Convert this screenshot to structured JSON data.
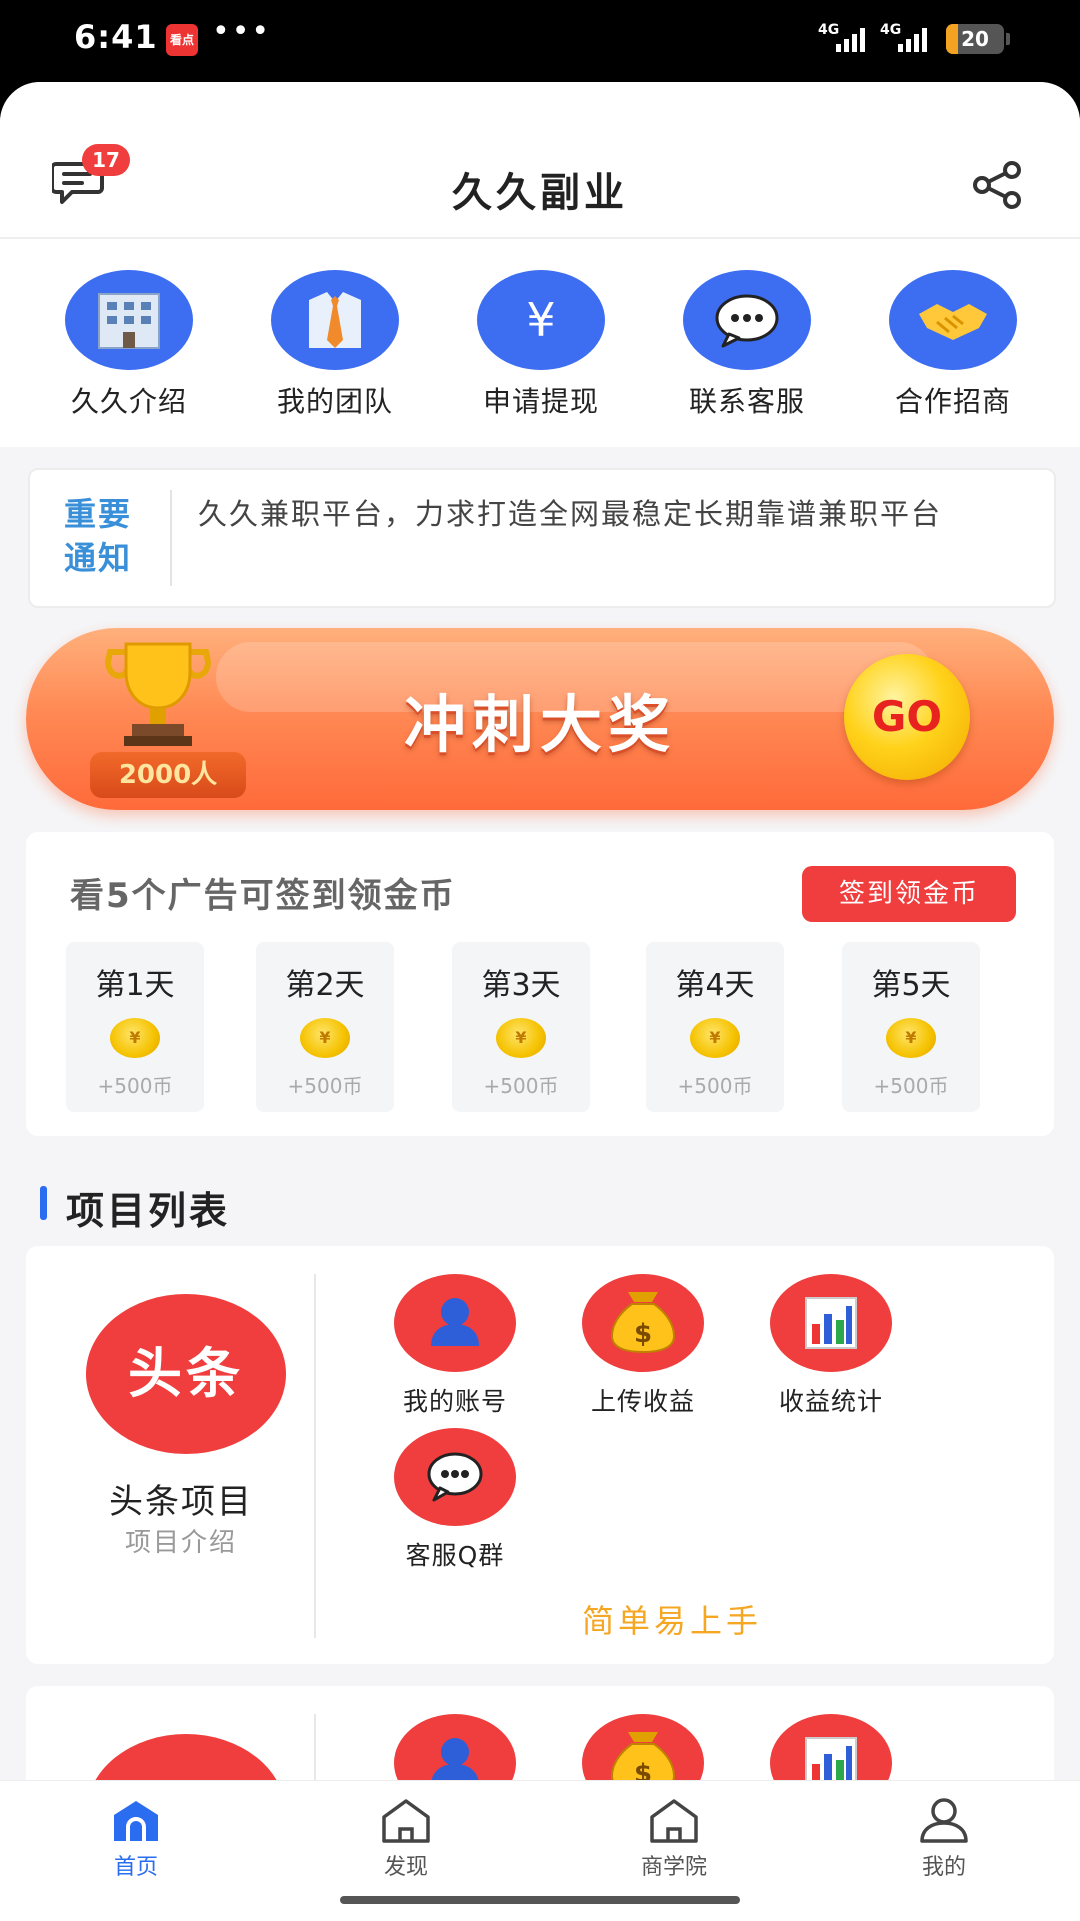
{
  "status_bar": {
    "time": "6:41",
    "app_badge": "看点",
    "dots": "•••",
    "network1": "4G",
    "network2": "4G",
    "battery": "20",
    "battery_level": 0.2,
    "battery_color": "#f3a321"
  },
  "header": {
    "title": "久久副业",
    "message_badge": "17",
    "message_icon": "chat-icon",
    "share_icon": "share-icon"
  },
  "quick_menu": [
    {
      "label": "久久介绍",
      "icon": "building-icon"
    },
    {
      "label": "我的团队",
      "icon": "shirt-tie-icon"
    },
    {
      "label": "申请提现",
      "icon": "yen-icon"
    },
    {
      "label": "联系客服",
      "icon": "chat-bubble-icon"
    },
    {
      "label": "合作招商",
      "icon": "handshake-icon"
    }
  ],
  "notice": {
    "tag": "重要通知",
    "text": "久久兼职平台，力求打造全网最稳定长期靠谱兼职平台"
  },
  "banner": {
    "title": "冲刺大奖",
    "count": "2000人",
    "go": "GO"
  },
  "signin": {
    "title": "看5个广告可签到领金币",
    "button": "签到领金币",
    "days": [
      {
        "label": "第1天",
        "reward": "+500币"
      },
      {
        "label": "第2天",
        "reward": "+500币"
      },
      {
        "label": "第3天",
        "reward": "+500币"
      },
      {
        "label": "第4天",
        "reward": "+500币"
      },
      {
        "label": "第5天",
        "reward": "+500币"
      }
    ],
    "coin_symbol": "¥"
  },
  "projects": {
    "section_title": "项目列表",
    "items": [
      {
        "badge": "头条",
        "name": "头条项目",
        "sub": "项目介绍",
        "actions": [
          {
            "label": "我的账号",
            "icon": "user-icon"
          },
          {
            "label": "上传收益",
            "icon": "money-bag-icon"
          },
          {
            "label": "收益统计",
            "icon": "bar-chart-icon"
          },
          {
            "label": "客服Q群",
            "icon": "chat-bubble-icon"
          }
        ],
        "tagline": "简单易上手"
      }
    ]
  },
  "bottom_nav": [
    {
      "label": "首页",
      "icon": "home-icon",
      "active": true
    },
    {
      "label": "发现",
      "icon": "discover-icon",
      "active": false
    },
    {
      "label": "商学院",
      "icon": "school-icon",
      "active": false
    },
    {
      "label": "我的",
      "icon": "profile-icon",
      "active": false
    }
  ],
  "colors": {
    "accent_blue": "#2a6df0",
    "accent_red": "#f03d3d",
    "accent_orange": "#f5a623"
  }
}
